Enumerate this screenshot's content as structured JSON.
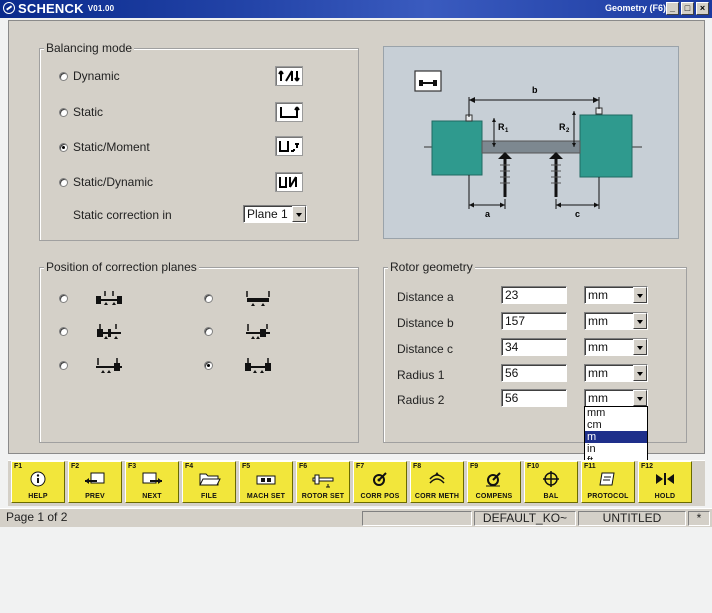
{
  "titlebar": {
    "brand": "SCHENCK",
    "version": "V01.00",
    "right_title": "Geometry (F6)",
    "controls": [
      "_",
      "□",
      "×"
    ]
  },
  "balancing_mode": {
    "title": "Balancing mode",
    "options": [
      {
        "label": "Dynamic",
        "selected": false
      },
      {
        "label": "Static",
        "selected": false
      },
      {
        "label": "Static/Moment",
        "selected": true
      },
      {
        "label": "Static/Dynamic",
        "selected": false
      }
    ],
    "static_correction_label": "Static correction in",
    "static_correction_value": "Plane 1"
  },
  "correction_planes": {
    "title": "Position of correction planes",
    "selected_index": 5
  },
  "rotor_geometry": {
    "title": "Rotor geometry",
    "rows": [
      {
        "label": "Distance a",
        "value": "23",
        "unit": "mm"
      },
      {
        "label": "Distance b",
        "value": "157",
        "unit": "mm"
      },
      {
        "label": "Distance c",
        "value": "34",
        "unit": "mm"
      },
      {
        "label": "Radius 1",
        "value": "56",
        "unit": "mm"
      },
      {
        "label": "Radius 2",
        "value": "56",
        "unit": "mm"
      }
    ],
    "unit_options": [
      "mm",
      "cm",
      "m",
      "in",
      "ft"
    ],
    "highlighted_unit": "m"
  },
  "diagram": {
    "b_label": "b",
    "a_label": "a",
    "c_label": "c",
    "r1_label": "R",
    "r1_sub": "1",
    "r2_label": "R",
    "r2_sub": "2"
  },
  "fkeys": [
    {
      "num": "F1",
      "label": "HELP",
      "icon": "info-icon"
    },
    {
      "num": "F2",
      "label": "PREV",
      "icon": "prev-icon"
    },
    {
      "num": "F3",
      "label": "NEXT",
      "icon": "next-icon"
    },
    {
      "num": "F4",
      "label": "FILE",
      "icon": "folder-icon"
    },
    {
      "num": "F5",
      "label": "MACH SET",
      "icon": "machine-icon"
    },
    {
      "num": "F6",
      "label": "ROTOR SET",
      "icon": "rotor-icon"
    },
    {
      "num": "F7",
      "label": "CORR POS",
      "icon": "corr-pos-icon"
    },
    {
      "num": "F8",
      "label": "CORR METH",
      "icon": "corr-meth-icon"
    },
    {
      "num": "F9",
      "label": "COMPENS",
      "icon": "compens-icon"
    },
    {
      "num": "F10",
      "label": "BAL",
      "icon": "crosshair-icon"
    },
    {
      "num": "F11",
      "label": "PROTOCOL",
      "icon": "protocol-icon"
    },
    {
      "num": "F12",
      "label": "HOLD",
      "icon": "hold-icon"
    }
  ],
  "status": {
    "page": "Page 1 of 2",
    "profile": "DEFAULT_KO~",
    "file": "UNTITLED",
    "flag": "*"
  },
  "colors": {
    "titlebar": "#0a2a8c",
    "fkey_yellow": "#f2e63b",
    "rotor_teal": "#2f9a8e",
    "panel": "#d4d0c8"
  }
}
